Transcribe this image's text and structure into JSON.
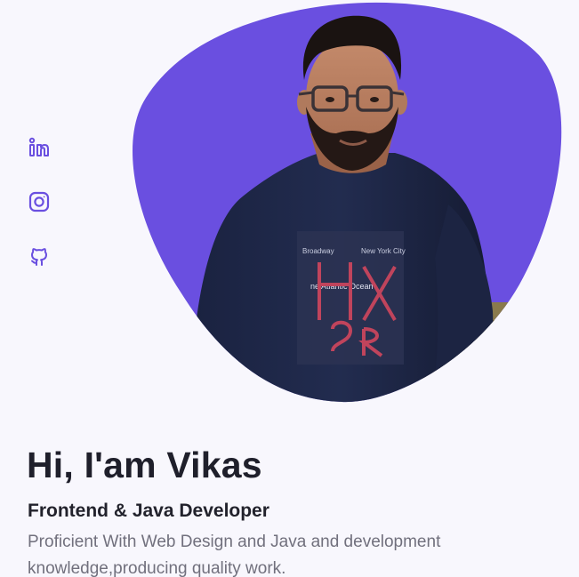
{
  "social": {
    "links": [
      {
        "icon": "linkedin-icon"
      },
      {
        "icon": "instagram-icon"
      },
      {
        "icon": "github-icon"
      }
    ]
  },
  "hero": {
    "title": "Hi, I'am Vikas",
    "subtitle": "Frontend & Java Developer",
    "description": "Proficient With Web Design and Java and development knowledge,producing quality work."
  },
  "colors": {
    "accent": "#6a4fe0",
    "background": "#f8f7fd",
    "heading": "#1f1f2b",
    "body_text": "#71707d"
  }
}
